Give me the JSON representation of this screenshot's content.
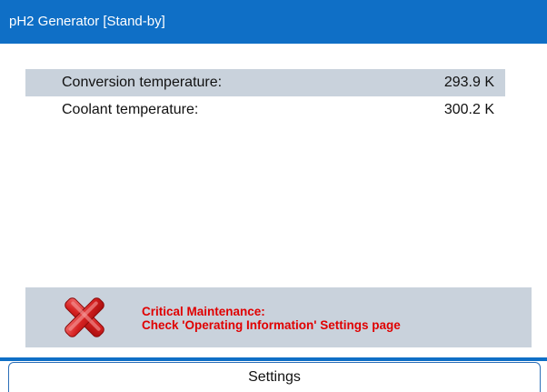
{
  "header": {
    "title": "pH2 Generator  [Stand-by]"
  },
  "readings": [
    {
      "label": "Conversion temperature:",
      "value": "293.9 K"
    },
    {
      "label": "Coolant temperature:",
      "value": "300.2 K"
    }
  ],
  "alert": {
    "icon": "red-x-icon",
    "line1": "Critical Maintenance:",
    "line2": "Check 'Operating Information' Settings page",
    "text_color": "#e00000"
  },
  "footer": {
    "settings_label": "Settings"
  },
  "colors": {
    "accent": "#0f6fc6",
    "panel": "#c9d2dc"
  }
}
